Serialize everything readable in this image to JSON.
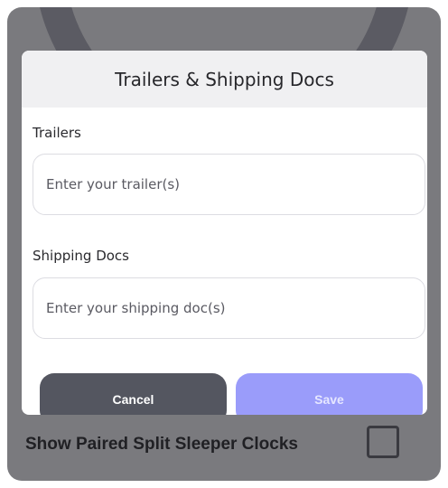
{
  "background": {
    "setting_label": "Show Paired Split Sleeper Clocks",
    "setting_checked": false
  },
  "dialog": {
    "title": "Trailers & Shipping Docs",
    "trailers": {
      "label": "Trailers",
      "value": "",
      "placeholder": "Enter your trailer(s)"
    },
    "shipping_docs": {
      "label": "Shipping Docs",
      "value": "",
      "placeholder": "Enter your shipping doc(s)"
    },
    "cancel_label": "Cancel",
    "save_label": "Save"
  },
  "colors": {
    "overlay": "#7a7a7e",
    "cancel_button": "#545660",
    "save_button": "#9a9cfa",
    "header_background": "#f0f0f2"
  }
}
